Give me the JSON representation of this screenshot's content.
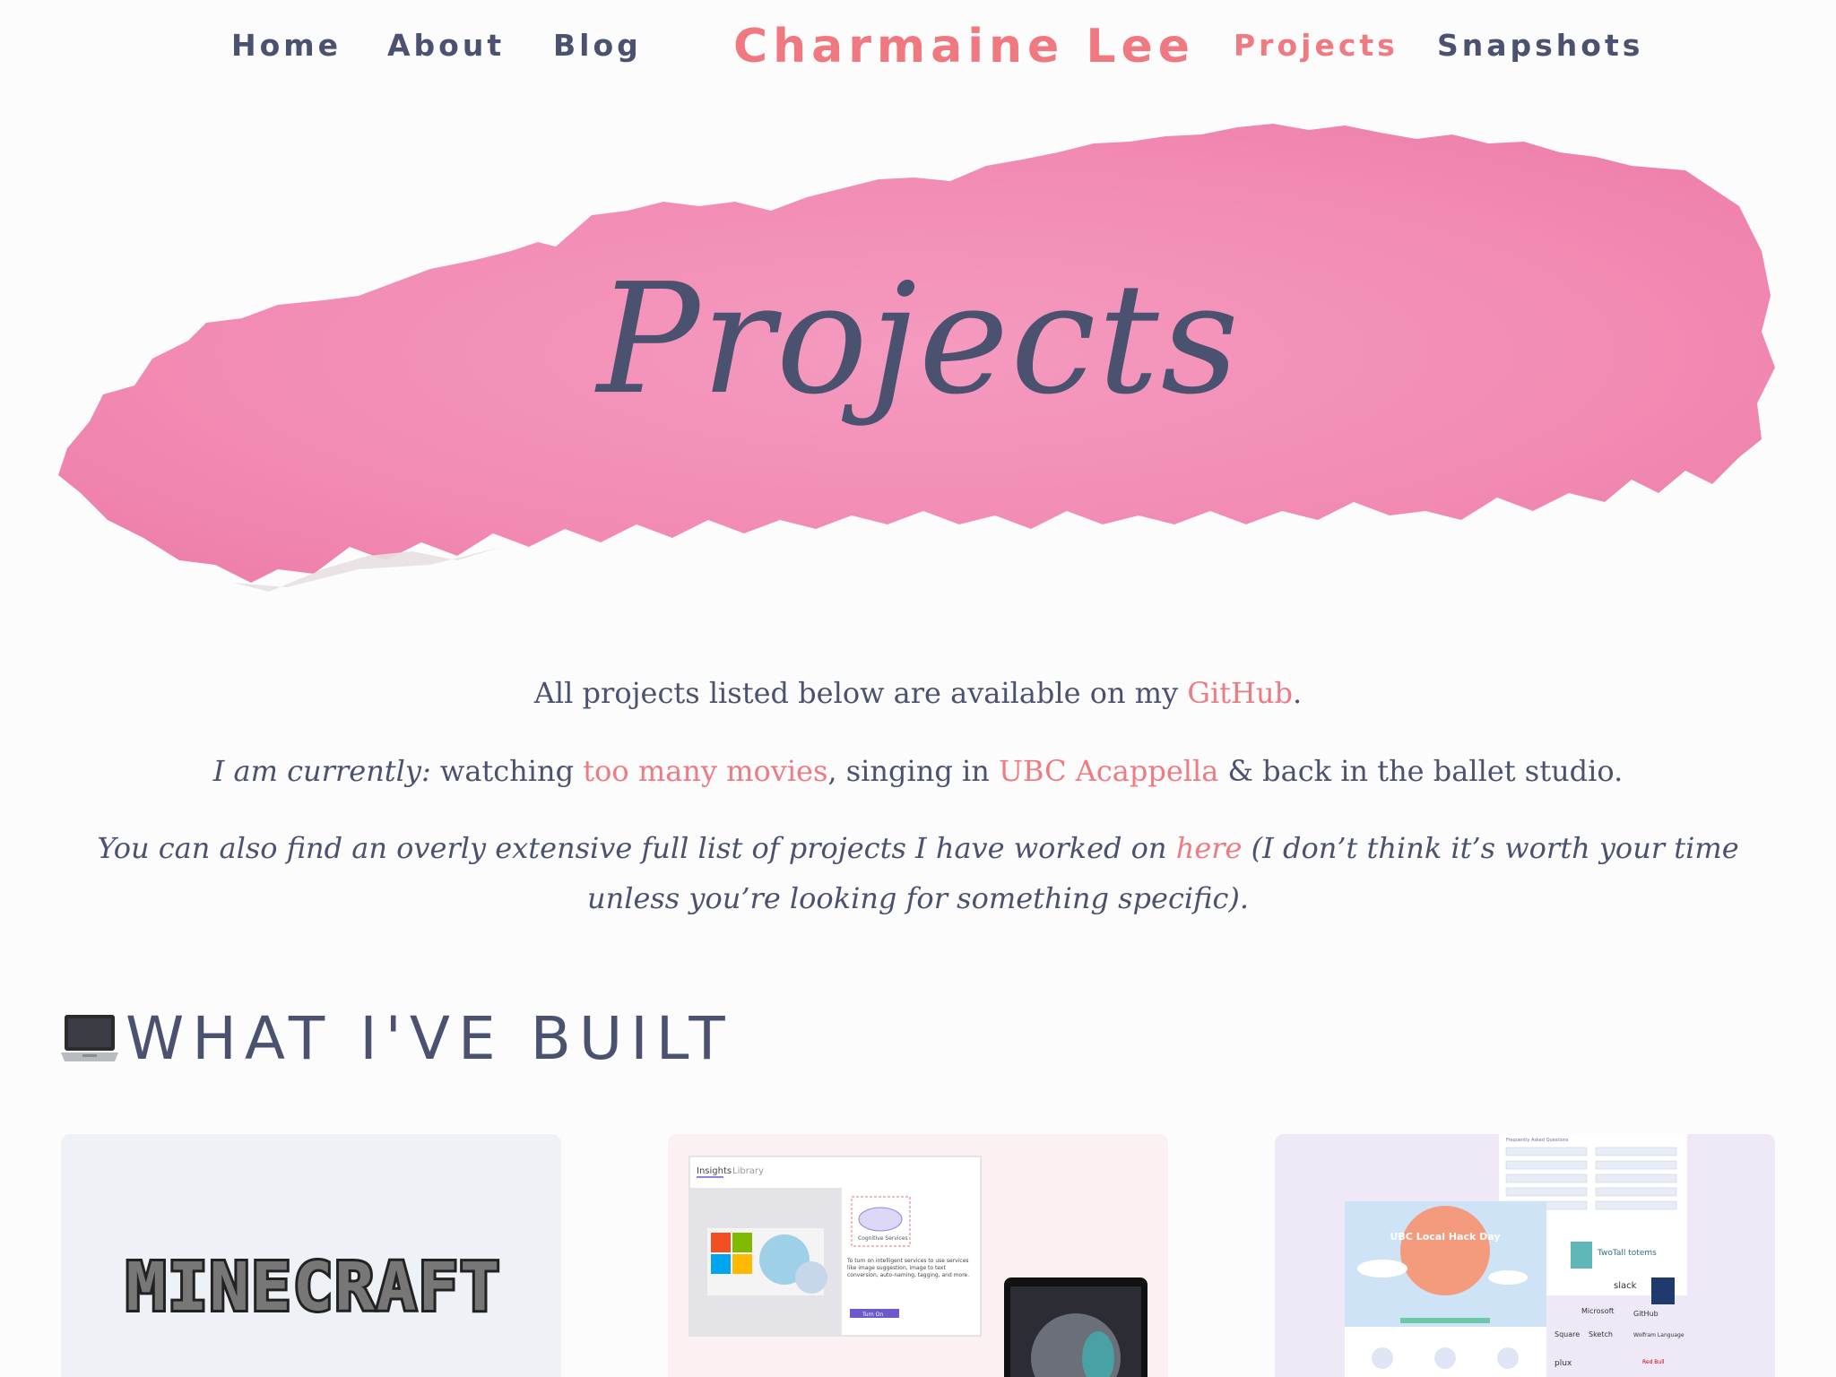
{
  "nav": {
    "home": "Home",
    "about": "About",
    "blog": "Blog",
    "brand": "Charmaine Lee",
    "projects": "Projects",
    "snapshots": "Snapshots"
  },
  "hero": {
    "title": "Projects"
  },
  "intro": {
    "p1_before": "All projects listed below are available on my ",
    "p1_link": "GitHub",
    "p1_after": ".",
    "p2_em": "I am currently:",
    "p2_a": " watching ",
    "p2_link1": "too many movies",
    "p2_b": ", singing in ",
    "p2_link2": "UBC Acappella",
    "p2_c": " & back in the ballet studio.",
    "p3_before": "You can also find an overly extensive full list of projects I have worked on ",
    "p3_link": "here",
    "p3_after": " (I don’t think it’s worth your time unless you’re looking for something specific)."
  },
  "section": {
    "title": "WHAT I'VE BUILT",
    "icon": "laptop-icon"
  },
  "cards": {
    "card1": {
      "logo_text": "MINECRAFT"
    },
    "card2": {
      "tab_insights": "Insights",
      "tab_library": "Library",
      "service_label": "Cognitive Services",
      "description": "To turn on intelligent services to use services like image suggestion, image to text conversion, auto-naming, tagging, and more.",
      "button": "Turn On"
    },
    "card3": {
      "faq_title": "Frequently Asked Questions",
      "poster_title": "UBC Local Hack Day",
      "sponsor1": "TwoTall totems",
      "sponsor2": "slack",
      "sponsor3": "Microsoft",
      "sponsor4": "GitHub",
      "sponsor5": "Square",
      "sponsor6": "Sketch",
      "sponsor7": "Wolfram Language",
      "sponsor8": "plux",
      "sponsor9": "Red Bull"
    }
  },
  "colors": {
    "accent": "#ee7a82",
    "text": "#4a5270",
    "hero_pink": "#f38fb4"
  }
}
